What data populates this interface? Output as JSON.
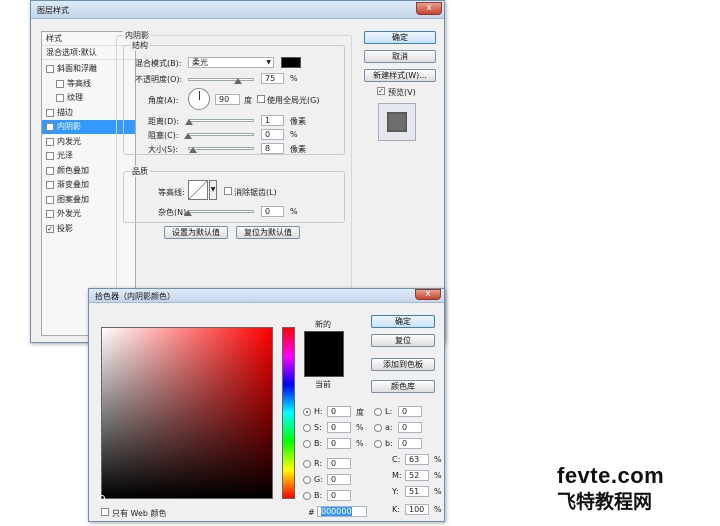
{
  "layer_style": {
    "title": "图层样式",
    "close": "x",
    "styles_header": "样式",
    "blend_options": "混合选项:默认",
    "items": [
      {
        "label": "斜面和浮雕",
        "checked": false
      },
      {
        "label": "等高线",
        "checked": false
      },
      {
        "label": "纹理",
        "checked": false
      },
      {
        "label": "描边",
        "checked": false
      },
      {
        "label": "内阴影",
        "checked": true
      },
      {
        "label": "内发光",
        "checked": false
      },
      {
        "label": "光泽",
        "checked": false
      },
      {
        "label": "颜色叠加",
        "checked": false
      },
      {
        "label": "渐变叠加",
        "checked": false
      },
      {
        "label": "图案叠加",
        "checked": false
      },
      {
        "label": "外发光",
        "checked": false
      },
      {
        "label": "投影",
        "checked": true
      }
    ],
    "section_title": "内阴影",
    "structure": {
      "title": "结构",
      "blend_mode_label": "混合模式(B):",
      "blend_mode_value": "柔光",
      "opacity_label": "不透明度(O):",
      "opacity_value": "75",
      "opacity_unit": "%",
      "opacity_level": 0.75,
      "angle_label": "角度(A):",
      "angle_value": "90",
      "angle_unit": "度",
      "global_light_label": "使用全局光(G)",
      "distance_label": "距离(D):",
      "distance_value": "1",
      "distance_unit": "像素",
      "choke_label": "阻塞(C):",
      "choke_value": "0",
      "choke_unit": "%",
      "size_label": "大小(S):",
      "size_value": "8",
      "size_unit": "像素",
      "color_swatch": "#000000"
    },
    "quality": {
      "title": "品质",
      "contour_label": "等高线:",
      "antialias_label": "消除锯齿(L)",
      "noise_label": "杂色(N):",
      "noise_value": "0",
      "noise_unit": "%"
    },
    "set_default": "设置为默认值",
    "reset_default": "复位为默认值",
    "ok": "确定",
    "cancel": "取消",
    "new_style": "新建样式(W)...",
    "preview_label": "预览(V)",
    "preview_checked": true
  },
  "picker": {
    "title": "拾色器（内阴影颜色）",
    "close": "x",
    "ok": "确定",
    "reset": "复位",
    "add_swatch": "添加到色板",
    "color_libs": "颜色库",
    "new_label": "新的",
    "current_label": "当前",
    "new_color": "#000000",
    "current_color": "#000000",
    "hue": "#ff0000",
    "fields": {
      "H": {
        "label": "H:",
        "value": "0",
        "unit": "度"
      },
      "S": {
        "label": "S:",
        "value": "0",
        "unit": "%"
      },
      "B": {
        "label": "B:",
        "value": "0",
        "unit": "%"
      },
      "R": {
        "label": "R:",
        "value": "0"
      },
      "G": {
        "label": "G:",
        "value": "0"
      },
      "Bl": {
        "label": "B:",
        "value": "0"
      },
      "L": {
        "label": "L:",
        "value": "0"
      },
      "a": {
        "label": "a:",
        "value": "0"
      },
      "b": {
        "label": "b:",
        "value": "0"
      },
      "C": {
        "label": "C:",
        "value": "63",
        "unit": "%"
      },
      "M": {
        "label": "M:",
        "value": "52",
        "unit": "%"
      },
      "Y": {
        "label": "Y:",
        "value": "51",
        "unit": "%"
      },
      "K": {
        "label": "K:",
        "value": "100",
        "unit": "%"
      }
    },
    "hex_label": "#",
    "hex_value": "000000",
    "web_only_label": "只有 Web 颜色"
  },
  "watermark": {
    "line1": "fevte.com",
    "line2": "飞特教程网"
  }
}
